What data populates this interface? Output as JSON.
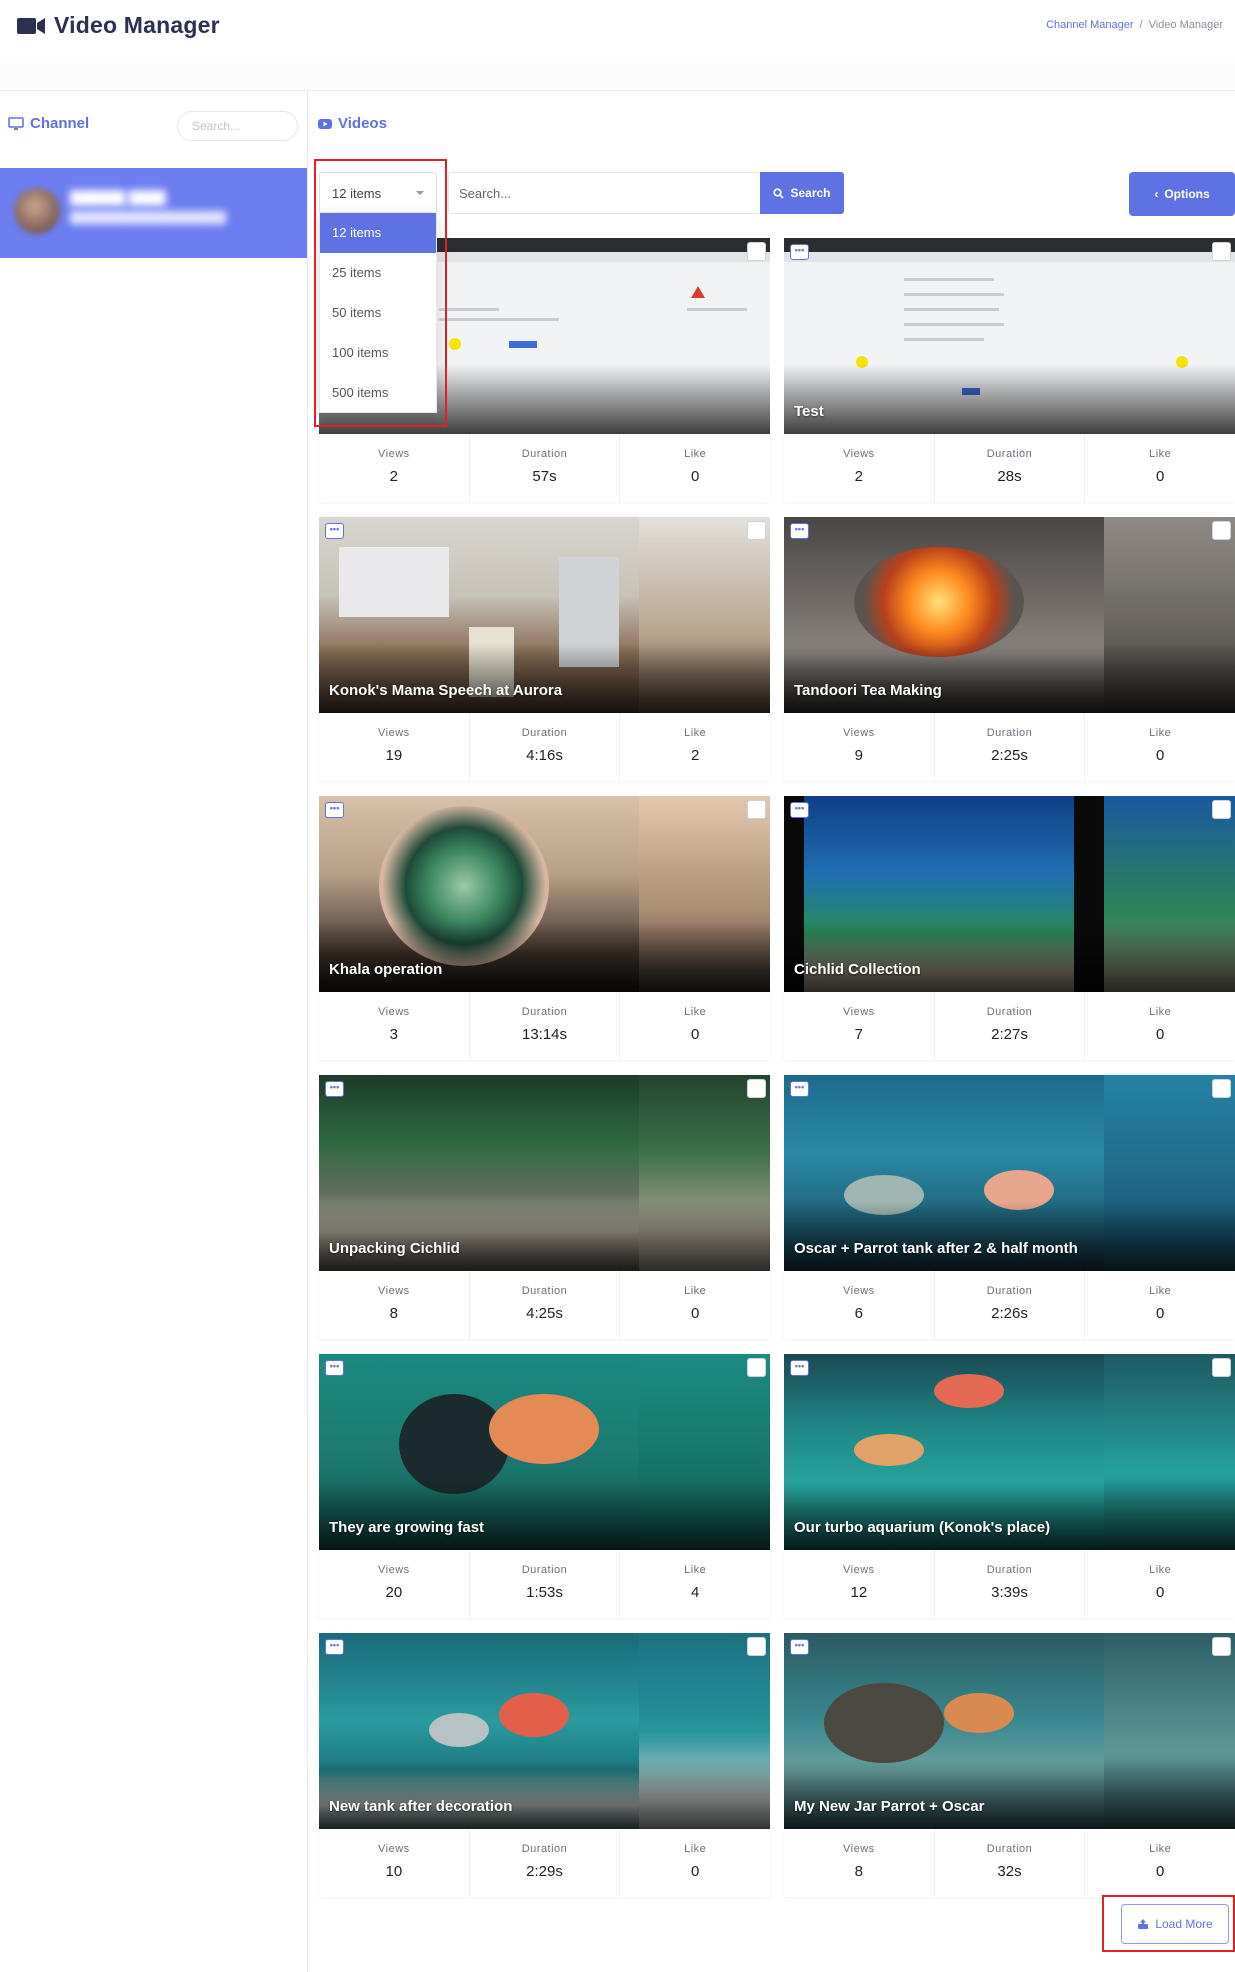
{
  "header": {
    "title": "Video Manager",
    "breadcrumb": [
      "Channel Manager",
      "Video Manager"
    ]
  },
  "sidebar": {
    "heading": "Channel",
    "search_placeholder": "Search..."
  },
  "main": {
    "heading": "Videos",
    "per_page_selected": "12 items",
    "per_page_options": [
      "12 items",
      "25 items",
      "50 items",
      "100 items",
      "500 items"
    ],
    "search_placeholder": "Search...",
    "search_button": "Search",
    "options_button": "Options",
    "stat_labels": {
      "views": "Views",
      "duration": "Duration",
      "like": "Like"
    },
    "videos": [
      {
        "title": "",
        "views": "2",
        "duration": "57s",
        "like": "0"
      },
      {
        "title": "Test",
        "views": "2",
        "duration": "28s",
        "like": "0"
      },
      {
        "title": "Konok's Mama Speech at Aurora",
        "views": "19",
        "duration": "4:16s",
        "like": "2"
      },
      {
        "title": "Tandoori Tea Making",
        "views": "9",
        "duration": "2:25s",
        "like": "0"
      },
      {
        "title": "Khala operation",
        "views": "3",
        "duration": "13:14s",
        "like": "0"
      },
      {
        "title": "Cichlid Collection",
        "views": "7",
        "duration": "2:27s",
        "like": "0"
      },
      {
        "title": "Unpacking Cichlid",
        "views": "8",
        "duration": "4:25s",
        "like": "0"
      },
      {
        "title": "Oscar + Parrot tank after 2 & half month",
        "views": "6",
        "duration": "2:26s",
        "like": "0"
      },
      {
        "title": "They are growing fast",
        "views": "20",
        "duration": "1:53s",
        "like": "4"
      },
      {
        "title": "Our turbo aquarium (Konok's place)",
        "views": "12",
        "duration": "3:39s",
        "like": "0"
      },
      {
        "title": "New tank after decoration",
        "views": "10",
        "duration": "2:29s",
        "like": "0"
      },
      {
        "title": "My New Jar Parrot + Oscar",
        "views": "8",
        "duration": "32s",
        "like": "0"
      }
    ],
    "load_more": "Load More"
  },
  "colors": {
    "accent": "#5e72e4",
    "highlight": "#e41f26"
  }
}
